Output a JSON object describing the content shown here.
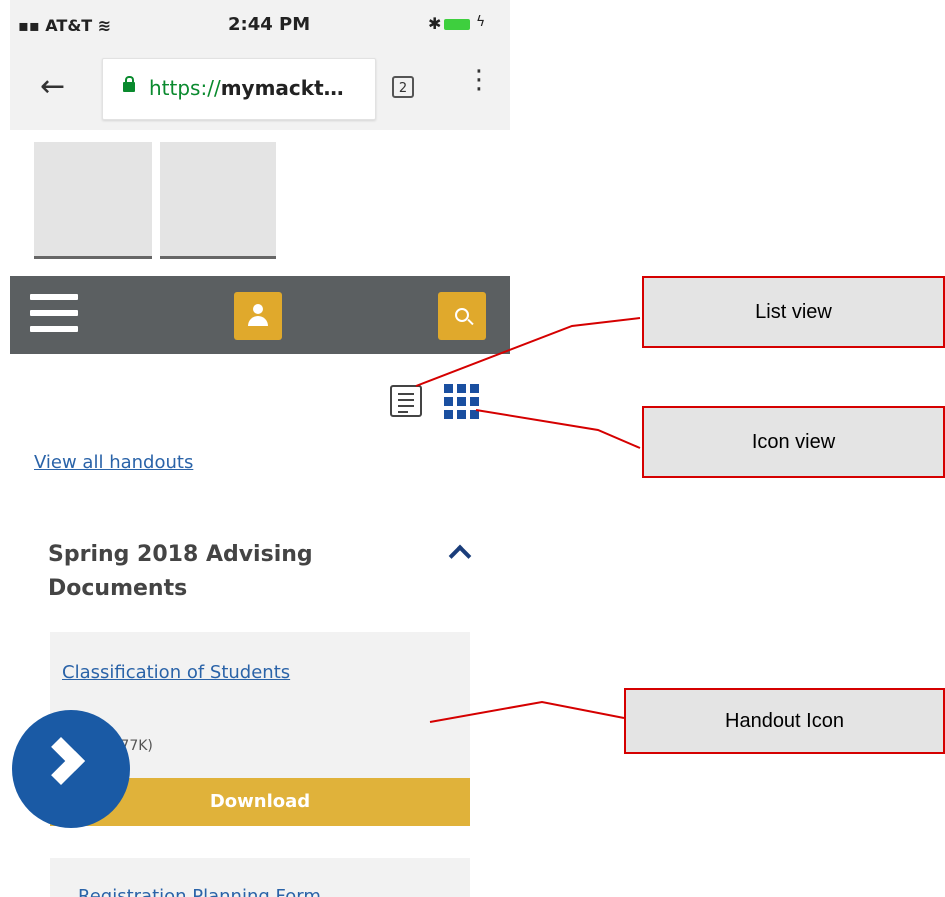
{
  "status_bar": {
    "carrier": "AT&T",
    "time": "2:44 PM"
  },
  "browser": {
    "url_scheme": "https://",
    "url_host": "mymackt…",
    "tab_count": "2"
  },
  "colors": {
    "navbar": "#5b5f61",
    "accent_gold": "#e0a92c",
    "link_blue": "#2a63a8",
    "callout_border": "#d50000"
  },
  "nav_icons": [
    "menu-icon",
    "user-icon",
    "search-icon"
  ],
  "view_toggle": [
    "list-view-icon",
    "grid-view-icon"
  ],
  "content": {
    "view_all_link": "View all handouts",
    "section_title": "Spring 2018 Advising Documents",
    "handouts": [
      {
        "title": "Classification of Students",
        "meta": "(.pdf, 177K)",
        "download_label": "Download"
      },
      {
        "title": "Registration Planning Form"
      }
    ]
  },
  "annotations": {
    "list_view": "List view",
    "icon_view": "Icon view",
    "handout_icon": "Handout Icon"
  }
}
